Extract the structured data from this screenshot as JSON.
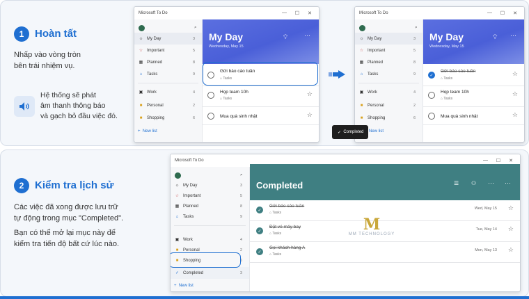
{
  "step1": {
    "number": "1",
    "title": "Hoàn tất",
    "instruction": [
      "Nhấp vào vòng tròn",
      "bên trái nhiệm vụ."
    ],
    "note": [
      "Hệ thống sẽ phát",
      "âm thanh thông báo",
      "và gạch bỏ đầu việc đó."
    ]
  },
  "step2": {
    "number": "2",
    "title": "Kiểm tra lịch sử",
    "para1": [
      "Các việc đã xong được lưu trữ",
      "tự động trong mục \"Completed\"."
    ],
    "para2": [
      "Bạn có thể mở lại mục này để",
      "kiểm tra tiến độ bất cứ lúc nào."
    ]
  },
  "app": {
    "window_title": "Microsoft To Do",
    "new_list": "New list",
    "controls": [
      "—",
      "☐",
      "✕"
    ]
  },
  "sidebar": {
    "items": [
      {
        "label": "My Day",
        "count": "3",
        "icon": "sun-icon"
      },
      {
        "label": "Important",
        "count": "5",
        "icon": "star-icon"
      },
      {
        "label": "Planned",
        "count": "8",
        "icon": "calendar-icon"
      },
      {
        "label": "Tasks",
        "count": "9",
        "icon": "home-icon"
      },
      {
        "label": "Work",
        "count": "4",
        "icon": "briefcase-icon"
      },
      {
        "label": "Personal",
        "count": "2",
        "icon": "folder-icon"
      },
      {
        "label": "Shopping",
        "count": "6",
        "icon": "bag-icon"
      }
    ],
    "completed": {
      "label": "Completed",
      "count": "3"
    }
  },
  "myday": {
    "title": "My Day",
    "date": "Wednesday, May 15",
    "tasks": [
      {
        "name": "Gửi báo cáo tuần",
        "sub": "Tasks"
      },
      {
        "name": "Họp team 10h",
        "sub": "Tasks"
      },
      {
        "name": "Mua quà sinh nhật",
        "sub": ""
      }
    ]
  },
  "toast": {
    "text": "Completed"
  },
  "completed_view": {
    "title": "Completed",
    "tasks": [
      {
        "name": "Gửi báo cáo tuần",
        "sub": "Tasks",
        "date": "Wed, May 15"
      },
      {
        "name": "Đặt vé máy bay",
        "sub": "Tasks",
        "date": "Tue, May 14"
      },
      {
        "name": "Gọi khách hàng A",
        "sub": "Tasks",
        "date": "Mon, May 13"
      }
    ]
  },
  "watermark": {
    "mark": "M",
    "text": "MM TECHNOLOGY"
  },
  "colors": {
    "accent": "#1f6fd1",
    "myday_header": "#5b6fe0",
    "completed_header": "#3f7f82"
  }
}
